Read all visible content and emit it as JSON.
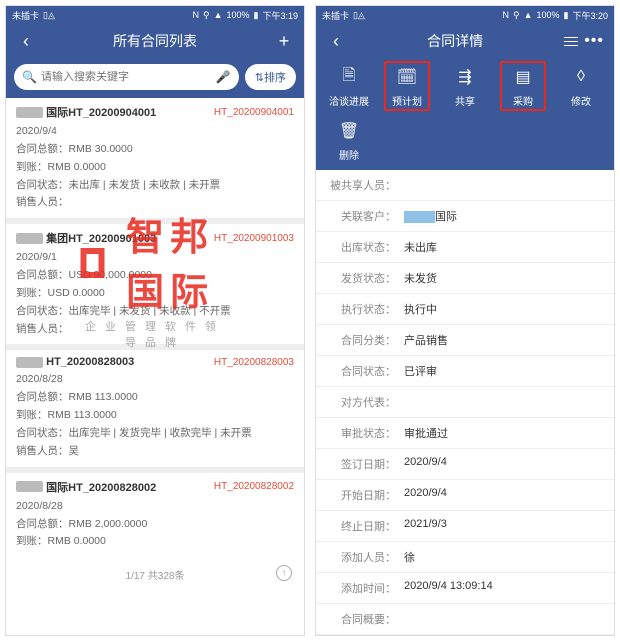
{
  "watermark": {
    "brand": "智邦国际",
    "sub": "企业管理软件领导品牌"
  },
  "left": {
    "status": {
      "sim": "未插卡",
      "battery": "100%",
      "time": "下午3:19",
      "nfc": "N",
      "bt": "⚲"
    },
    "header": {
      "title": "所有合同列表"
    },
    "search": {
      "placeholder": "请输入搜索关键字",
      "sort": "排序"
    },
    "contracts": [
      {
        "name_suffix": "国际HT_20200904001",
        "code": "HT_20200904001",
        "date": "2020/9/4",
        "lines": [
          "合同总额：RMB 30.0000",
          "到账：RMB 0.0000",
          "合同状态：未出库 | 未发货 | 未收款 | 未开票",
          "销售人员："
        ]
      },
      {
        "name_suffix": "集团HT_20200901003",
        "code": "HT_20200901003",
        "date": "2020/9/1",
        "lines": [
          "合同总额：USD 90,000.0000",
          "到账：USD 0.0000",
          "合同状态：出库完毕 | 未发货 | 未收款 | 不开票",
          "销售人员："
        ]
      },
      {
        "name_suffix": "HT_20200828003",
        "code": "HT_20200828003",
        "date": "2020/8/28",
        "lines": [
          "合同总额：RMB 113.0000",
          "到账：RMB 113.0000",
          "合同状态：出库完毕 | 发货完毕 | 收款完毕 | 未开票",
          "销售人员：吴"
        ]
      },
      {
        "name_suffix": "国际HT_20200828002",
        "code": "HT_20200828002",
        "date": "2020/8/28",
        "lines": [
          "合同总额：RMB 2,000.0000",
          "到账：RMB 0.0000"
        ]
      }
    ],
    "pager": "1/17 共328条"
  },
  "right": {
    "status": {
      "sim": "未插卡",
      "battery": "100%",
      "time": "下午3:20",
      "nfc": "N",
      "bt": "⚲"
    },
    "header": {
      "title": "合同详情"
    },
    "actions": [
      {
        "label": "洽谈进展",
        "icon": "search-doc-icon",
        "highlight": false
      },
      {
        "label": "预计划",
        "icon": "calendar-icon",
        "highlight": true
      },
      {
        "label": "共享",
        "icon": "share-icon",
        "highlight": false
      },
      {
        "label": "采购",
        "icon": "document-icon",
        "highlight": true
      },
      {
        "label": "修改",
        "icon": "eraser-icon",
        "highlight": false
      },
      {
        "label": "删除",
        "icon": "trash-icon",
        "highlight": false
      }
    ],
    "hidden_code": "HT_20200904001",
    "details": [
      {
        "lab": "被共享人员：",
        "val": ""
      },
      {
        "lab": "关联客户：",
        "val": "__国际",
        "blur": true
      },
      {
        "lab": "出库状态：",
        "val": "未出库"
      },
      {
        "lab": "发货状态：",
        "val": "未发货"
      },
      {
        "lab": "执行状态：",
        "val": "执行中"
      },
      {
        "lab": "合同分类：",
        "val": "产品销售"
      },
      {
        "lab": "合同状态：",
        "val": "已评审"
      },
      {
        "lab": "对方代表：",
        "val": ""
      },
      {
        "lab": "审批状态：",
        "val": "审批通过"
      },
      {
        "lab": "签订日期：",
        "val": "2020/9/4"
      },
      {
        "lab": "开始日期：",
        "val": "2020/9/4"
      },
      {
        "lab": "终止日期：",
        "val": "2021/9/3"
      },
      {
        "lab": "添加人员：",
        "val": "徐"
      },
      {
        "lab": "添加时间：",
        "val": "2020/9/4 13:09:14"
      },
      {
        "lab": "合同概要：",
        "val": ""
      }
    ]
  }
}
